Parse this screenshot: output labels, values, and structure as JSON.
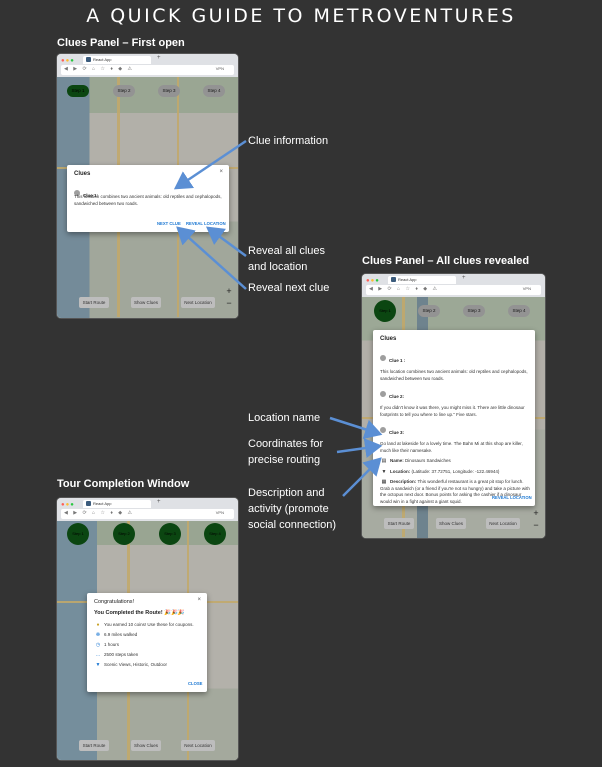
{
  "page_title": "A QUICK GUIDE TO METROVENTURES",
  "sections": {
    "first_open": "Clues Panel – First open",
    "all_revealed": "Clues Panel – All clues revealed",
    "completion": "Tour Completion Window"
  },
  "browser": {
    "tab_title": "React App",
    "new_tab": "+",
    "vpn_label": "VPN"
  },
  "map_steps": [
    "Step 1",
    "Step 2",
    "Step 3",
    "Step 4"
  ],
  "map_bottom": {
    "start_route": "Start Route",
    "show_clues": "Show Clues",
    "next_location": "Next Location"
  },
  "zoom": {
    "plus": "+",
    "minus": "−"
  },
  "clues_panel_first": {
    "title": "Clues",
    "close": "×",
    "clue1_label": "Clue 1:",
    "clue1_text": "This location combines two ancient animals: old reptiles and cephalopods, sandwiched between two roads.",
    "next_clue": "NEXT CLUE",
    "reveal_location": "REVEAL LOCATION"
  },
  "clues_panel_all": {
    "title": "Clues",
    "close": "×",
    "clue1_label": "Clue 1 :",
    "clue1_text": "This location combines two ancient animals: old reptiles and cephalopods, sandwiched between two roads.",
    "clue2_label": "Clue 2:",
    "clue2_text": "If you didn't know it was there, you might miss it. There are little dinosaur footprints to tell you where to line up.\" Five stars.",
    "clue3_label": "Clue 3:",
    "clue3_text": "Go land at lakeside for a lovely time. The Bahn Mi at this shop are killer, much like their namesake.",
    "name_label": "Name:",
    "name_value": "Dinosaurs Sandwiches",
    "location_label": "Location:",
    "location_value": "(Latitude: 37.72751, Longitude: -122.46944)",
    "description_label": "Description:",
    "description_value": "This wonderful restaurant is a great pit stop for lunch. Grab a sandwich (or a friend if you're not so hungry) and take a picture with the octopus next door. Bonus points for asking the cashier if a dinosaur would win in a fight against a giant squid.",
    "reveal_location": "REVEAL LOCATION"
  },
  "completion": {
    "title": "Congratulations!",
    "close": "×",
    "heading": "You Completed the Route! 🎉🎉🎉",
    "items": [
      {
        "icon": "coin-icon",
        "glyph": "●",
        "text": "You earned 10 coins! Use these for coupons."
      },
      {
        "icon": "steps-icon",
        "glyph": "☸",
        "text": "6.9 miles walked"
      },
      {
        "icon": "clock-icon",
        "glyph": "◷",
        "text": "1 hours"
      },
      {
        "icon": "walk-icon",
        "glyph": "…",
        "text": "2500 steps taken"
      },
      {
        "icon": "pin-icon",
        "glyph": "▼",
        "text": "Scenic Views, Historic, Outdoor"
      }
    ],
    "close_button": "CLOSE"
  },
  "annotations": {
    "clue_information": "Clue information",
    "reveal_all": [
      "Reveal all clues",
      "and location"
    ],
    "reveal_next": "Reveal next clue",
    "location_name": "Location name",
    "coordinates": [
      "Coordinates for",
      "precise routing"
    ],
    "description": [
      "Description and",
      "activity (promote",
      "social connection)"
    ]
  },
  "colors": {
    "background": "#333333",
    "accent_blue": "#1976d2",
    "step_green": "#0f5a16",
    "arrow_blue": "#5b8fd4"
  }
}
